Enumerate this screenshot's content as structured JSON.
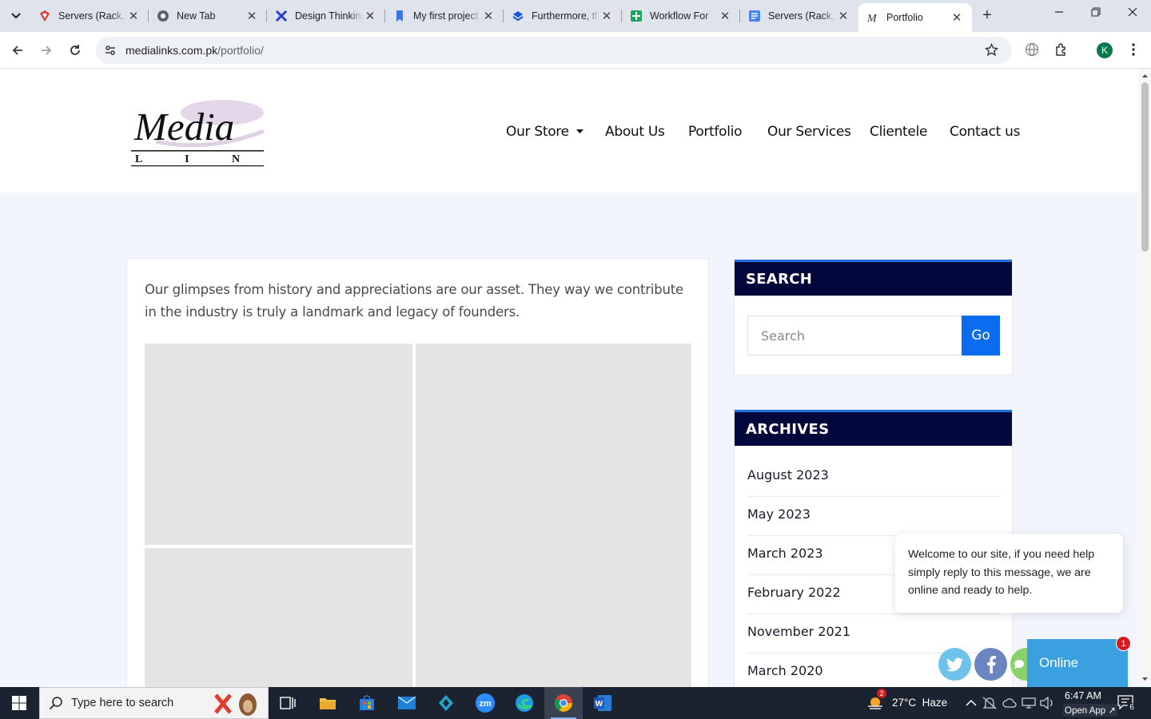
{
  "browser": {
    "tabs": [
      {
        "title": "Servers (Rack, Tower)",
        "icon": "gem-red-icon"
      },
      {
        "title": "New Tab",
        "icon": "chrome-icon"
      },
      {
        "title": "Design Thinking",
        "icon": "x-logo-icon"
      },
      {
        "title": "My first project",
        "icon": "bookmark-blue-icon"
      },
      {
        "title": "Furthermore, the",
        "icon": "layers-blue-icon"
      },
      {
        "title": "Workflow For",
        "icon": "sheets-green-icon"
      },
      {
        "title": "Servers (Rack, Tower)",
        "icon": "docs-blue-icon"
      },
      {
        "title": "Portfolio",
        "icon": "media-m-icon"
      }
    ],
    "active_tab_index": 7,
    "url_host": "medialinks.com.pk",
    "url_path": "/portfolio/",
    "profile_initial": "K"
  },
  "site": {
    "logo_word": "Media",
    "logo_sub": "L I N K S",
    "nav": [
      "Our Store",
      "About Us",
      "Portfolio",
      "Our Services",
      "Clientele",
      "Contact us"
    ],
    "intro_text": "Our glimpses from history and appreciations are our asset. They way we contribute in the industry is truly a landmark and legacy of founders.",
    "search_widget": {
      "title": "SEARCH",
      "placeholder": "Search",
      "button": "Go"
    },
    "archives_widget": {
      "title": "ARCHIVES",
      "items": [
        "August 2023",
        "May 2023",
        "March 2023",
        "February 2022",
        "November 2021",
        "March 2020"
      ]
    },
    "chat": {
      "message": "Welcome to our site, if you need help simply reply to this message, we are online and ready to help.",
      "online_label": "Online",
      "unread_count": "1"
    }
  },
  "taskbar": {
    "search_placeholder": "Type here to search",
    "weather": "27°C  Haze",
    "weather_badge": "2",
    "time": "6:47 AM",
    "open_app": "Open App ↗",
    "notification_count": "6"
  },
  "colors": {
    "widget_header": "#02073b",
    "widget_accent": "#1f6fde",
    "go_button": "#0b6cf0",
    "page_bg": "#f2f6fc",
    "online_button": "#3aa0e0"
  }
}
